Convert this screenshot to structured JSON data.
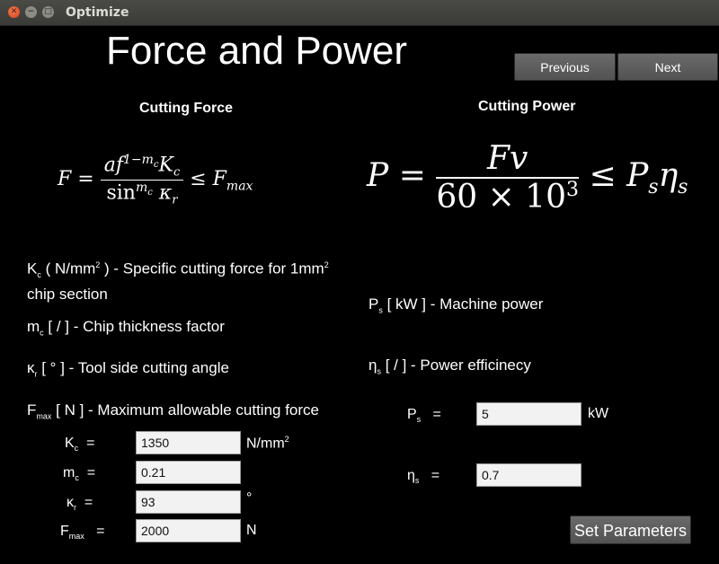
{
  "window": {
    "title": "Optimize"
  },
  "page": {
    "title": "Force and Power"
  },
  "nav": {
    "previous": "Previous",
    "next": "Next"
  },
  "force": {
    "heading": "Cutting Force",
    "formula": {
      "lhs": "F",
      "eq": "=",
      "num_a": "af",
      "num_exp": "1−m",
      "num_exp_sub": "c",
      "num_K": "K",
      "num_K_sub": "c",
      "den_sin": "sin",
      "den_exp": "m",
      "den_exp_sub": "c",
      "den_kappa": "κ",
      "den_kappa_sub": "r",
      "le": "≤",
      "rhs": "F",
      "rhs_sub": "max"
    },
    "desc": {
      "kc_sym": "K",
      "kc_sub": "c",
      "kc_text1": " ( N/mm",
      "kc_sup": "2",
      "kc_text2": " ) - Specific cutting force for 1mm",
      "kc_sup2": "2",
      "kc_text3": "chip section",
      "mc_sym": "m",
      "mc_sub": "c",
      "mc_text": " [ / ] - Chip thickness factor",
      "kr_sym": "κ",
      "kr_sub": "r",
      "kr_text": " [ ° ] - Tool side cutting angle",
      "fmax_sym": "F",
      "fmax_sub": "max",
      "fmax_text": " [ N ] - Maximum allowable cutting force"
    },
    "fields": {
      "kc": {
        "sym": "K",
        "sub": "c",
        "eq": "=",
        "value": "1350",
        "unit": "N/mm",
        "unit_sup": "2"
      },
      "mc": {
        "sym": "m",
        "sub": "c",
        "eq": "=",
        "value": "0.21",
        "unit": ""
      },
      "kr": {
        "sym": "κ",
        "sub": "r",
        "eq": "=",
        "value": "93",
        "unit": "°"
      },
      "fmax": {
        "sym": "F",
        "sub": "max",
        "eq": "=",
        "value": "2000",
        "unit": "N"
      }
    }
  },
  "power": {
    "heading": "Cutting Power",
    "formula": {
      "lhs": "P",
      "eq": "=",
      "num": "Fv",
      "den": "60 × 10",
      "den_sup": "3",
      "le": "≤",
      "rhs_P": "P",
      "rhs_P_sub": "s",
      "rhs_eta": "η",
      "rhs_eta_sub": "s"
    },
    "desc": {
      "ps_sym": "P",
      "ps_sub": "s",
      "ps_text": " [ kW ] - Machine power",
      "eta_sym": "η",
      "eta_sub": "s",
      "eta_text": " [ / ] - Power efficinecy"
    },
    "fields": {
      "ps": {
        "sym": "P",
        "sub": "s",
        "eq": "=",
        "value": "5",
        "unit": "kW"
      },
      "eta": {
        "sym": "η",
        "sub": "s",
        "eq": "=",
        "value": "0.7"
      }
    }
  },
  "actions": {
    "set_parameters": "Set Parameters"
  }
}
